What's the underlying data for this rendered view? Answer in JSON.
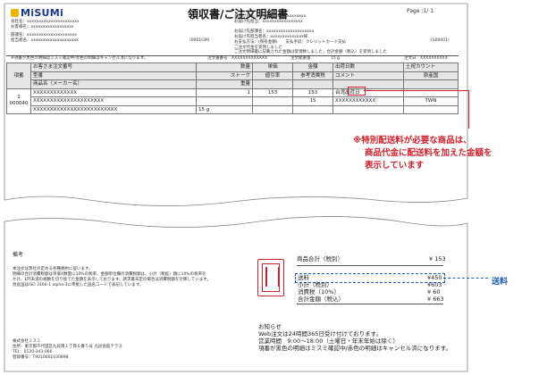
{
  "header": {
    "logo_text": "MiSUMi",
    "title": "領収書/ご注文明細書",
    "page": "Page :1/ 1"
  },
  "customer": {
    "company_label": "会社名：xxxxxxxxxxxxxxxxxxxxxx",
    "customer_name": "お客様名：xxxxxxxxxxxxxxxxxx",
    "dept": "部課名：xxxxxxxxxxxxxxxxxxxxx",
    "person": "担当者名：xxxxxxxxxxxxxxxxxxxx"
  },
  "shipping": {
    "dest_name": "お届け先名：xxxxxxxxxxxxxxxxxxxx",
    "dest_contact": "お届け先担当：xxxxxxxxxxxxxxxxx",
    "dest_dept": "お届け先部課名：xxxxxxxxxxxxxxxxxxxx",
    "dest_person": "お届け先担当者名：xxxxxxxxxxxxxx様",
    "payment": "お支払方法：(保有金額)　　支払手段：クレジットカード支払",
    "code_left": "(0001GM)",
    "code_right": "(S00001)",
    "receipt_note": "ご注文代金を受領しました",
    "accepted_note": "ご注文明細書に記載された金額は受領致しました。合計金額（税込）を受領しました"
  },
  "order_bar": {
    "cancel_note": "※項番が黒色の明細はミスミ確認中/赤色の明細はキャンセル済になります。",
    "order_no": "注文書番号　XXXXXXXXXXXXX",
    "order_weight": "注文総重量　　　　　15 g",
    "order_date": "注文日　XXXXXXXXXX"
  },
  "table": {
    "headers": {
      "no": "項番",
      "cust_part": "お客さま注文番号",
      "model": "型番",
      "product": "商品名（メーカー名）",
      "qty": "数量",
      "stock": "ストーク",
      "weight": "重量",
      "unit_price": "単価",
      "tax_rate": "値引率",
      "ref_tax": "参考消費税",
      "amount": "金額",
      "ship_days": "出荷日数",
      "count_up": "土祝カウント",
      "origin": "原産国",
      "comment": "コメント"
    },
    "rows": [
      {
        "no": "1",
        "sub_no": "000040",
        "cust_part": "XXXXXXXXXXXXX",
        "model": "XXXXXXXXXXXXXXXXXXXXX",
        "product": "XXXXXXXXXXXXXXXXXXXXXXXXX",
        "qty": "1",
        "weight": "15 g",
        "unit_price": "153",
        "amount": "153",
        "ref_tax": "15",
        "ship_days": "台湾出荷日",
        "count_up": "XXXXXXXXXXXX",
        "origin": "TWN"
      }
    ]
  },
  "annotation": {
    "line1": "※特別配送料が必要な商品は、",
    "line2": "商品代金に配送料を加えた金額を",
    "line3": "表示しています",
    "blue_label": "送料"
  },
  "bottom": {
    "remarks_label": "備考",
    "remarks_text": [
      "本注文は弊社の定める各種規約に従います。",
      "明細の合計消費税額は単価X数量に10%の税率、金額単位欄の消費税額は、小計（税抜）額に10%の税率を",
      "かけ、1円未満の端数を切り捨てた金額を表示しております。請求書未定の場合は消費税額を計算しています。",
      "原産国はISO 3166-1 alpha-3に準拠した国名コードで表記しています。"
    ],
    "company": "株式会社ミスミ",
    "address": "住所：東京都千代田区九段南１丁目６番５号 九段会館テラス",
    "tel": "TEL：0120-343-066",
    "reg_no": "登録番号：T9010601030898"
  },
  "totals": {
    "product_total_label": "商品合計（税別）",
    "product_total": "¥ 153",
    "shipping_label": "送料",
    "shipping": "¥450",
    "subtotal_label": "小計（税別）",
    "subtotal": "¥603",
    "tax_label": "消費税（10%）",
    "tax": "¥ 60",
    "total_label": "合計金額（税込）",
    "total": "¥ 663"
  },
  "notice": {
    "title": "お知らせ",
    "line1": "Web注文は24時間365日受け付けております。",
    "line2": "営業時間　9:00～18:00（土曜日・年末年始は除く）",
    "line3": "項番が黒色の明細はミスミ確認中/赤色の明細はキャンセル済になります。"
  },
  "colors": {
    "accent_red": "#d0202e",
    "accent_blue": "#1f5fbf",
    "logo_blue": "#1b3a8c"
  }
}
